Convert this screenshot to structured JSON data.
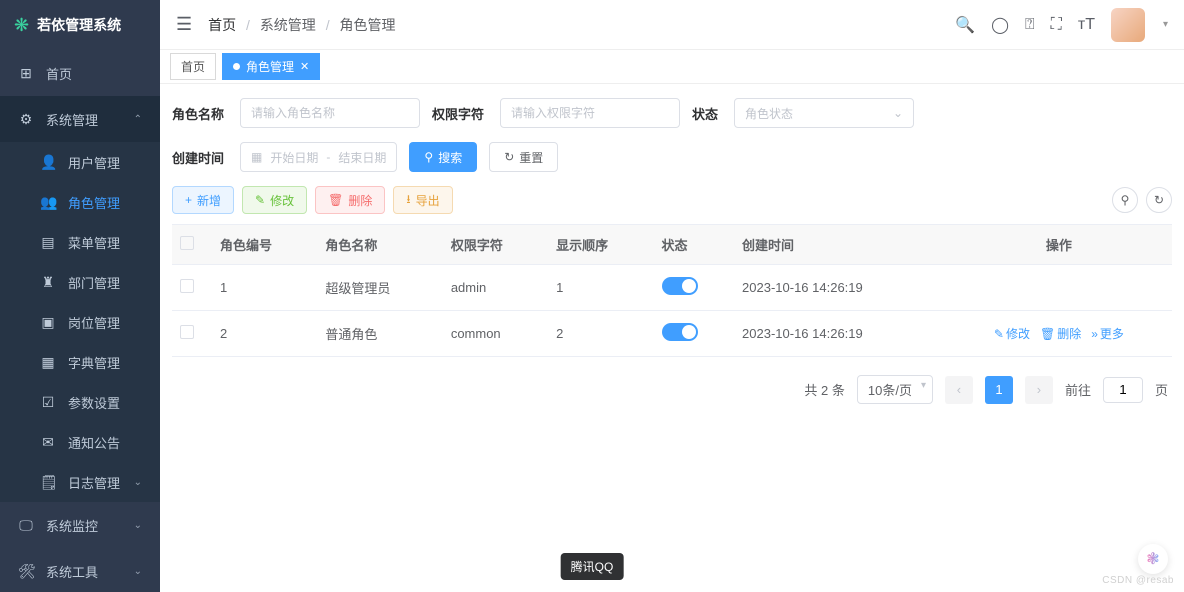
{
  "brand": {
    "name": "若依管理系统"
  },
  "sidebar": [
    {
      "ico": "⊞",
      "label": "首页"
    },
    {
      "ico": "⚙",
      "label": "系统管理",
      "open": true
    },
    {
      "ico": "👤",
      "label": "用户管理",
      "sub": true
    },
    {
      "ico": "👥",
      "label": "角色管理",
      "sub": true,
      "active": true
    },
    {
      "ico": "▤",
      "label": "菜单管理",
      "sub": true
    },
    {
      "ico": "♜",
      "label": "部门管理",
      "sub": true
    },
    {
      "ico": "▣",
      "label": "岗位管理",
      "sub": true
    },
    {
      "ico": "▦",
      "label": "字典管理",
      "sub": true
    },
    {
      "ico": "☑",
      "label": "参数设置",
      "sub": true
    },
    {
      "ico": "✉",
      "label": "通知公告",
      "sub": true
    },
    {
      "ico": "🗒",
      "label": "日志管理",
      "sub": true,
      "chev": true
    },
    {
      "ico": "🖵",
      "label": "系统监控",
      "chev": true
    },
    {
      "ico": "🛠",
      "label": "系统工具",
      "chev": true
    }
  ],
  "breadcrumb": {
    "a": "首页",
    "b": "系统管理",
    "c": "角色管理"
  },
  "tabs": {
    "home": "首页",
    "active": "角色管理"
  },
  "search": {
    "roleName": {
      "label": "角色名称",
      "ph": "请输入角色名称"
    },
    "roleKey": {
      "label": "权限字符",
      "ph": "请输入权限字符"
    },
    "status": {
      "label": "状态",
      "ph": "角色状态"
    },
    "createTime": {
      "label": "创建时间",
      "start": "开始日期",
      "end": "结束日期",
      "dash": "-"
    },
    "searchBtn": "搜索",
    "resetBtn": "重置"
  },
  "toolbar": {
    "add": "新增",
    "edit": "修改",
    "del": "删除",
    "export": "导出"
  },
  "table": {
    "cols": {
      "id": "角色编号",
      "name": "角色名称",
      "key": "权限字符",
      "sort": "显示顺序",
      "status": "状态",
      "ctime": "创建时间",
      "op": "操作"
    },
    "rows": [
      {
        "id": "1",
        "name": "超级管理员",
        "key": "admin",
        "sort": "1",
        "ctime": "2023-10-16 14:26:19"
      },
      {
        "id": "2",
        "name": "普通角色",
        "key": "common",
        "sort": "2",
        "ctime": "2023-10-16 14:26:19"
      }
    ],
    "ops": {
      "edit": "修改",
      "del": "删除",
      "more": "更多"
    }
  },
  "pagination": {
    "total": "共 2 条",
    "pageSize": "10条/页",
    "current": "1",
    "gotoLabel": "前往",
    "unit": "页",
    "gotoVal": "1"
  },
  "tooltip": "腾讯QQ",
  "watermark": "CSDN @resab"
}
